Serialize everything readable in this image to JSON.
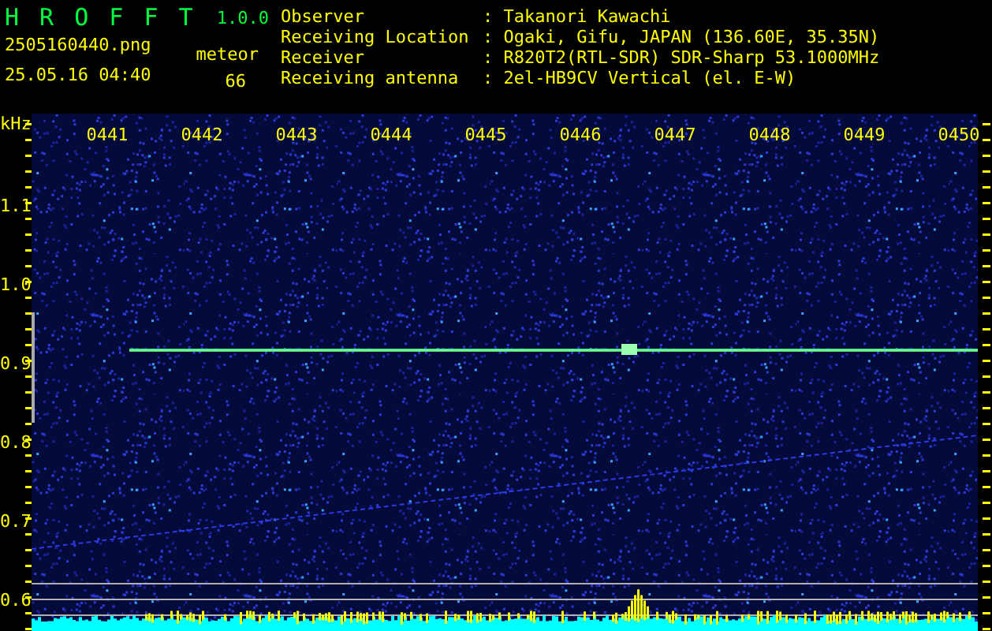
{
  "app": {
    "name": "H R O F F T",
    "version": "1.0.0"
  },
  "file": {
    "name": "2505160440.png",
    "datetime": "25.05.16 04:40"
  },
  "count": {
    "label": "meteor",
    "value": "66"
  },
  "info": [
    {
      "label": "Observer",
      "value": ": Takanori Kawachi"
    },
    {
      "label": "Receiving Location",
      "value": ": Ogaki, Gifu, JAPAN (136.60E, 35.35N)"
    },
    {
      "label": "Receiver",
      "value": ": R820T2(RTL-SDR) SDR-Sharp 53.1000MHz"
    },
    {
      "label": "Receiving antenna",
      "value": ": 2el-HB9CV Vertical (el. E-W)"
    }
  ],
  "plot": {
    "y_unit": "kHz",
    "y_labels": [
      "1.1",
      "1.0",
      "0.9",
      "0.8",
      "0.7",
      "0.6"
    ],
    "x_labels": [
      "0441",
      "0442",
      "0443",
      "0444",
      "0445",
      "0446",
      "0447",
      "0448",
      "0449",
      "0450"
    ]
  }
}
